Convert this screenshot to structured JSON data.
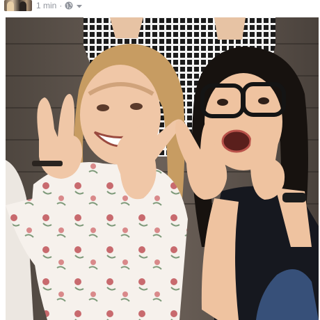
{
  "post": {
    "timestamp": "1 min",
    "separator": "·",
    "privacy_icon": "globe-icon",
    "menu_icon": "chevron-down-icon"
  },
  "colors": {
    "meta_text": "#90949c",
    "background": "#ffffff"
  }
}
